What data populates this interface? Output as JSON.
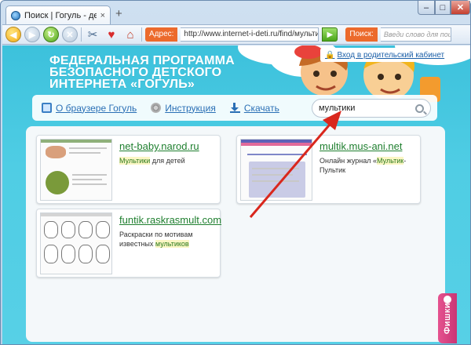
{
  "browser": {
    "tab_title": "Поиск | Гогуль - детский...",
    "tab_close": "×",
    "new_tab": "+",
    "window_controls": {
      "minimize": "–",
      "maximize": "□",
      "close": "✕"
    },
    "toolbar": {
      "address_label": "Адрес:",
      "address_value": "http://www.internet-i-deti.ru/find/мультики/",
      "go_symbol": "▶",
      "search_label": "Поиск:",
      "search_placeholder": "Введи слово для поиска"
    }
  },
  "page": {
    "brand": [
      "ФЕДЕРАЛЬНАЯ ПРОГРАММА",
      "БЕЗОПАСНОГО ДЕТСКОГО",
      "ИНТЕРНЕТА «ГОГУЛЬ»"
    ],
    "parent_link": "Вход в родительский кабинет",
    "nav": {
      "about": "О браузере Гогуль",
      "instructions": "Инструкция",
      "download": "Скачать"
    },
    "search_query": "мультики",
    "side_tab": "Фишки"
  },
  "results": [
    {
      "title": "net-baby.narod.ru",
      "desc_parts": [
        {
          "text": "Мультики",
          "hl": true
        },
        {
          "text": " для детей",
          "hl": false
        }
      ]
    },
    {
      "title": "multik.mus-ani.net",
      "desc_parts": [
        {
          "text": "Онлайн журнал «",
          "hl": false
        },
        {
          "text": "Мультик",
          "hl": true
        },
        {
          "text": "-Пультик",
          "hl": false
        }
      ]
    },
    {
      "title": "funtik.raskrasmult.com",
      "desc_parts": [
        {
          "text": "Раскраски по мотивам известных ",
          "hl": false
        },
        {
          "text": "мультиков",
          "hl": true
        }
      ]
    }
  ],
  "colors": {
    "page_bg": "#4fcde4",
    "link_green": "#1f7f2f",
    "link_blue": "#2a6fb5",
    "accent_orange": "#ec6a2c",
    "arrow_red": "#d9271d",
    "side_tab_pink": "#d23d7c"
  }
}
